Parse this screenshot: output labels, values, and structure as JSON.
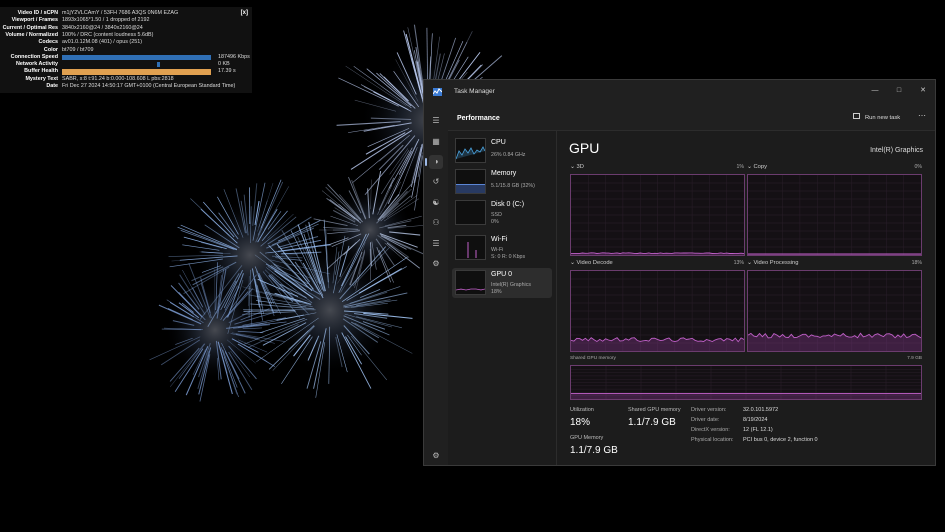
{
  "stats": {
    "close": "[x]",
    "rows": [
      {
        "label": "Video ID / sCPN",
        "value": "m1jY2VLCAmY / 53FH 7686 A3QS 0N6M EZAG"
      },
      {
        "label": "Viewport / Frames",
        "value": "1893x1065*1.50 / 1 dropped of 2192"
      },
      {
        "label": "Current / Optimal Res",
        "value": "3840x2160@24 / 3840x2160@24"
      },
      {
        "label": "Volume / Normalized",
        "value": "100% / DRC (content loudness 5.6dB)"
      },
      {
        "label": "Codecs",
        "value": "av01.0.12M.08 (401) / opus (251)"
      },
      {
        "label": "Color",
        "value": "bt709 / bt709"
      },
      {
        "label": "Connection Speed",
        "value": "187496 Kbps"
      },
      {
        "label": "Network Activity",
        "value": "0 KB"
      },
      {
        "label": "Buffer Health",
        "value": "17.39 s"
      },
      {
        "label": "Mystery Text",
        "value": "SABR, s:8 t:91.24 b:0.000-108.608 L pbs:2818"
      },
      {
        "label": "Date",
        "value": "Fri Dec 27 2024 14:50:17 GMT+0100 (Central European Standard Time)"
      }
    ],
    "connection_fill": 0.98,
    "buffer_fill": 0.98
  },
  "window": {
    "title": "Task Manager",
    "page": "Performance",
    "run_task": "Run new task",
    "more": "⋯"
  },
  "sidebar": [
    {
      "name": "CPU",
      "sub1": "26%  0.84 GHz",
      "sub2": ""
    },
    {
      "name": "Memory",
      "sub1": "5.1/15.8 GB (32%)",
      "sub2": ""
    },
    {
      "name": "Disk 0 (C:)",
      "sub1": "SSD",
      "sub2": "0%"
    },
    {
      "name": "Wi-Fi",
      "sub1": "Wi-Fi",
      "sub2": "S: 0  R: 0 Kbps"
    },
    {
      "name": "GPU 0",
      "sub1": "Intel(R) Graphics",
      "sub2": "18%"
    }
  ],
  "gpu": {
    "title": "GPU",
    "adapter": "Intel(R) Graphics",
    "engines": [
      {
        "name": "3D",
        "pct": "1%"
      },
      {
        "name": "Copy",
        "pct": "0%"
      },
      {
        "name": "Video Decode",
        "pct": "13%"
      },
      {
        "name": "Video Processing",
        "pct": "18%"
      }
    ],
    "shared_label": "Shared GPU memory",
    "shared_max": "7.9 GB",
    "utilization_label": "Utilization",
    "utilization": "18%",
    "shared_mem_label": "Shared GPU memory",
    "shared_mem": "1.1/7.9 GB",
    "gpu_mem_label": "GPU Memory",
    "gpu_mem": "1.1/7.9 GB",
    "info": [
      {
        "k": "Driver version:",
        "v": "32.0.101.5972"
      },
      {
        "k": "Driver date:",
        "v": "8/19/2024"
      },
      {
        "k": "DirectX version:",
        "v": "12 (FL 12.1)"
      },
      {
        "k": "Physical location:",
        "v": "PCI bus 0, device 2, function 0"
      }
    ]
  },
  "colors": {
    "accent": "#c060c8",
    "graph_border": "#6b3c6e",
    "cpu": "#4aa3df",
    "bar_blue": "#2f6fb5",
    "bar_orange": "#e0a050"
  }
}
